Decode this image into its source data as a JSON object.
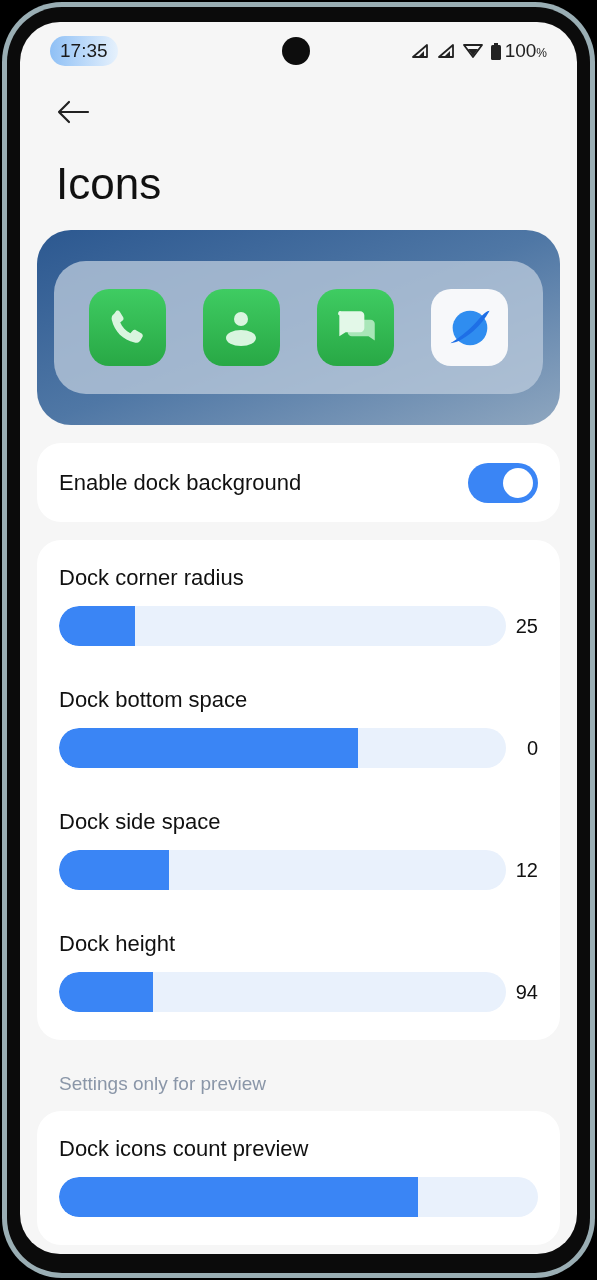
{
  "status_bar": {
    "time": "17:35",
    "battery": "100",
    "battery_unit": "%"
  },
  "title": "Icons",
  "dock_preview": {
    "apps": [
      {
        "kind": "phone"
      },
      {
        "kind": "contacts"
      },
      {
        "kind": "messages"
      },
      {
        "kind": "browser"
      }
    ]
  },
  "dock_background": {
    "label": "Enable dock background",
    "on": true
  },
  "sliders": [
    {
      "label": "Dock corner radius",
      "level": 0.17,
      "value": "25"
    },
    {
      "label": "Dock bottom space",
      "level": 0.67,
      "value": "0"
    },
    {
      "label": "Dock side space",
      "level": 0.245,
      "value": "12"
    },
    {
      "label": "Dock height",
      "level": 0.21,
      "value": "94"
    }
  ],
  "preview_section": {
    "header": "Settings only for preview",
    "sliders": [
      {
        "label": "Dock icons count preview",
        "level": 0.75
      }
    ]
  }
}
